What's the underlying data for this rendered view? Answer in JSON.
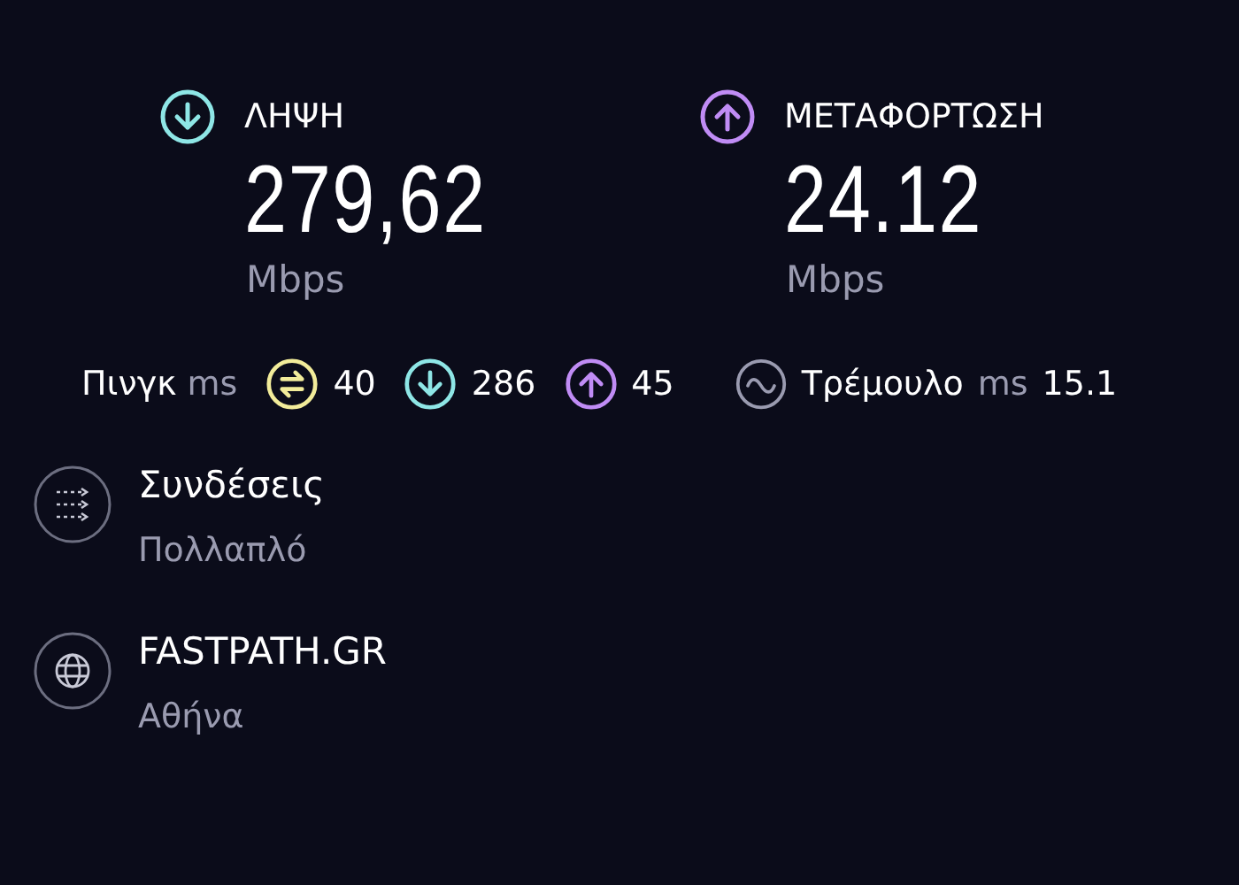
{
  "speeds": [
    {
      "kind": "download",
      "label": "ΛΗΨΗ",
      "value": "279,62",
      "unit": "Mbps"
    },
    {
      "kind": "upload",
      "label": "ΜΕΤΑΦΟΡΤΩΣΗ",
      "value": "24.12",
      "unit": "Mbps"
    }
  ],
  "ping": {
    "label": "Πινγκ",
    "unit": "ms",
    "values": [
      {
        "kind": "idle",
        "value": "40"
      },
      {
        "kind": "download",
        "value": "286"
      },
      {
        "kind": "upload",
        "value": "45"
      }
    ]
  },
  "jitter": {
    "label": "Τρέμουλο",
    "unit": "ms",
    "value": "15.1"
  },
  "info": [
    {
      "kind": "connections",
      "title": "Συνδέσεις",
      "subtitle": "Πολλαπλό"
    },
    {
      "kind": "server",
      "title": "FASTPATH.GR",
      "subtitle": "Αθήνα"
    }
  ]
}
